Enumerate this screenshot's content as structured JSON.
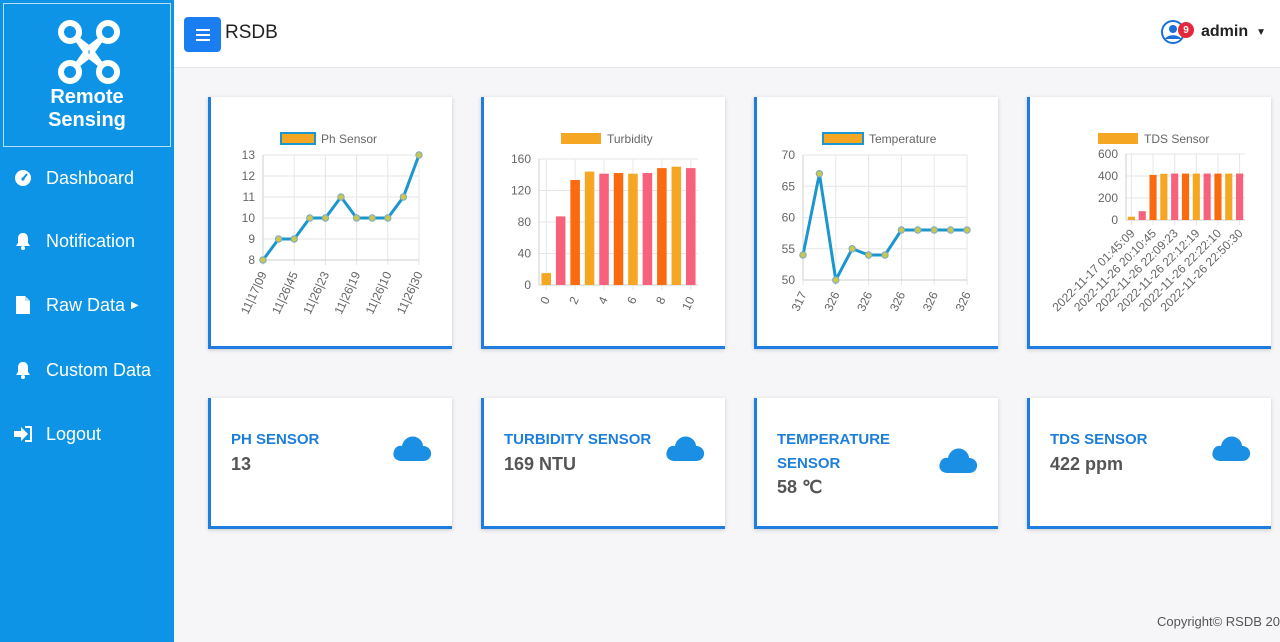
{
  "brand": {
    "line1": "Remote",
    "line2": "Sensing"
  },
  "sidebar": {
    "items": [
      {
        "label": "Dashboard",
        "icon": "gauge-icon"
      },
      {
        "label": "Notification",
        "icon": "bell-icon"
      },
      {
        "label": "Raw Data",
        "icon": "file-icon"
      },
      {
        "label": "Custom Data",
        "icon": "bell-icon"
      },
      {
        "label": "Logout",
        "icon": "sign-out-icon"
      }
    ]
  },
  "header": {
    "title": "RSDB",
    "user": "admin",
    "badge": "9"
  },
  "colors": {
    "sidebar": "#0e94e6",
    "accent": "#1f7ce0",
    "line": "#1b96cf",
    "pink": "#f7617b",
    "orange": "#f96b0e",
    "amber": "#f5a623"
  },
  "chart_data": [
    {
      "type": "line",
      "legend": "Ph Sensor",
      "x": [
        "11|17|09",
        "11|26|45",
        "11|26|23",
        "11|26|19",
        "11|26|10",
        "11|26|30"
      ],
      "values": [
        8,
        9,
        9,
        10,
        10,
        11,
        10,
        10,
        10,
        11,
        13
      ],
      "ylim": [
        8,
        13
      ],
      "yticks": [
        "13",
        "12",
        "11",
        "10",
        "9",
        "8"
      ]
    },
    {
      "type": "bar",
      "legend": "Turbidity",
      "x": [
        "0",
        "2",
        "4",
        "6",
        "8",
        "10"
      ],
      "values": [
        17,
        98,
        150,
        162,
        159,
        160,
        159,
        160,
        167,
        169,
        167
      ],
      "ylim": [
        0,
        180
      ],
      "yticks": [
        "160",
        "120",
        "80",
        "40",
        "0"
      ]
    },
    {
      "type": "line",
      "legend": "Temperature",
      "x": [
        "317",
        "326",
        "326",
        "326",
        "326",
        "326"
      ],
      "values": [
        54,
        67,
        50,
        55,
        54,
        54,
        58,
        58,
        58,
        58,
        58
      ],
      "ylim": [
        50,
        70
      ],
      "yticks": [
        "70",
        "65",
        "60",
        "55",
        "50"
      ]
    },
    {
      "type": "bar",
      "legend": "TDS Sensor",
      "x": [
        "2022-11-17 01:45:09",
        "2022-11-26 20:10:45",
        "2022-11-26 22:09:23",
        "2022-11-26 22:12:19",
        "2022-11-26 22:22:10",
        "2022-11-26 22:50:30"
      ],
      "values": [
        30,
        80,
        410,
        420,
        422,
        422,
        422,
        422,
        422,
        422,
        422
      ],
      "ylim": [
        0,
        600
      ],
      "yticks": [
        "600",
        "400",
        "200",
        "0"
      ]
    }
  ],
  "cards": [
    {
      "title": "PH SENSOR",
      "value": "13"
    },
    {
      "title": "TURBIDITY SENSOR",
      "value": "169 NTU"
    },
    {
      "title": "TEMPERATURE SENSOR",
      "value": "58 ℃"
    },
    {
      "title": "TDS SENSOR",
      "value": "422 ppm"
    }
  ],
  "footer": "Copyright© RSDB 20"
}
